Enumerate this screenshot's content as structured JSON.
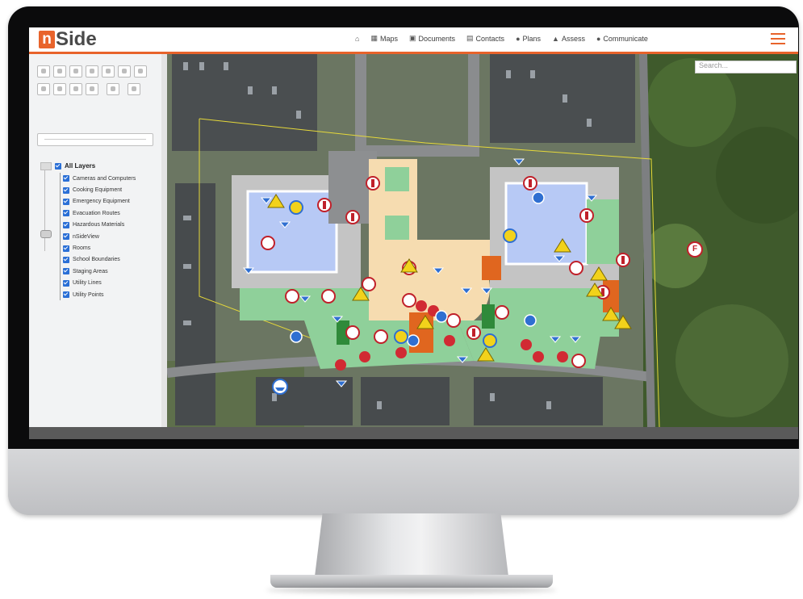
{
  "app": {
    "logo_first": "n",
    "logo_rest": "Side"
  },
  "nav": {
    "items": [
      {
        "label": "",
        "icon": "home-icon"
      },
      {
        "label": "Maps",
        "icon": "map-icon"
      },
      {
        "label": "Documents",
        "icon": "documents-icon"
      },
      {
        "label": "Contacts",
        "icon": "contacts-icon"
      },
      {
        "label": "Plans",
        "icon": "plans-icon"
      },
      {
        "label": "Assess",
        "icon": "warning-icon"
      },
      {
        "label": "Communicate",
        "icon": "chat-icon"
      }
    ]
  },
  "search": {
    "placeholder": "Search..."
  },
  "layers": {
    "all_label": "All Layers",
    "items": [
      {
        "label": "Cameras and Computers"
      },
      {
        "label": "Cooking Equipment"
      },
      {
        "label": "Emergency Equipment"
      },
      {
        "label": "Evacuation Routes"
      },
      {
        "label": "Hazardous Materials"
      },
      {
        "label": "nSideView"
      },
      {
        "label": "Rooms"
      },
      {
        "label": "School Boundaries"
      },
      {
        "label": "Staging Areas"
      },
      {
        "label": "Utility Lines"
      },
      {
        "label": "Utility Points"
      }
    ]
  },
  "map": {
    "marker_letter": "F"
  },
  "colors": {
    "accent": "#e8632b",
    "checkbox": "#2a6fd6",
    "room_green": "#8fd09a",
    "hall_tan": "#f6dcb0",
    "gym_blue": "#b7c9f5",
    "marker_red": "#c0202a",
    "marker_blue": "#2f6fd1",
    "hazard_yellow": "#f2d21b"
  }
}
